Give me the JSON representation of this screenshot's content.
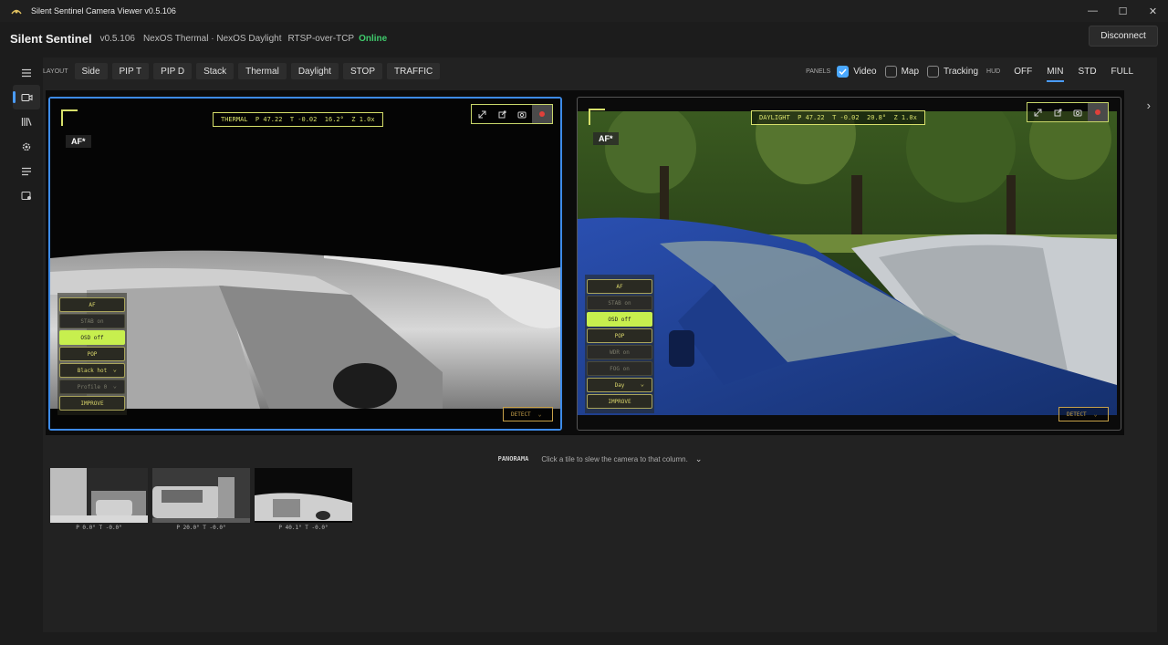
{
  "window": {
    "title": "Silent Sentinel Camera Viewer v0.5.106",
    "minimize": "—",
    "maximize": "☐",
    "close": "✕"
  },
  "header": {
    "brand": "Silent Sentinel",
    "version": "v0.5.106",
    "cameras": "NexOS Thermal · NexOS Daylight",
    "protocol": "RTSP-over-TCP",
    "status": "Online",
    "status_color": "#3fca6c",
    "disconnect_label": "Disconnect"
  },
  "sidebar": {
    "items": [
      {
        "icon": "menu-icon"
      },
      {
        "icon": "camera-icon",
        "active": true
      },
      {
        "icon": "library-icon"
      },
      {
        "icon": "gear-icon"
      },
      {
        "icon": "list-icon"
      },
      {
        "icon": "device-icon"
      }
    ]
  },
  "toolbar": {
    "layout_label": "LAYOUT",
    "layouts": [
      "Side",
      "PIP T",
      "PIP D",
      "Stack",
      "Thermal",
      "Daylight",
      "STOP",
      "TRAFFIC"
    ],
    "panels_label": "PANELS",
    "panels": [
      {
        "label": "Video",
        "checked": true
      },
      {
        "label": "Map",
        "checked": false
      },
      {
        "label": "Tracking",
        "checked": false
      }
    ],
    "hud_label": "HUD",
    "hud_options": [
      "OFF",
      "MIN",
      "STD",
      "FULL"
    ],
    "hud_selected": "MIN"
  },
  "thermal": {
    "hud": "THERMAL  P 47.22  T -0.02  16.2°  Z 1.0x",
    "af_tag": "AF*",
    "controls": [
      {
        "label": "AF",
        "state": "normal"
      },
      {
        "label": "STAB on",
        "state": "dim"
      },
      {
        "label": "OSD off",
        "state": "lit"
      },
      {
        "label": "POP",
        "state": "normal"
      },
      {
        "label": "Black hot",
        "state": "normal",
        "caret": true
      },
      {
        "label": "Profile 0",
        "state": "dim",
        "caret": true
      },
      {
        "label": "IMPROVE",
        "state": "normal"
      }
    ],
    "detect": "DETECT"
  },
  "daylight": {
    "hud": "DAYLIGHT  P 47.22  T -0.02  20.8°  Z 1.0x",
    "af_tag": "AF*",
    "controls": [
      {
        "label": "AF",
        "state": "normal"
      },
      {
        "label": "STAB on",
        "state": "dim"
      },
      {
        "label": "OSD off",
        "state": "lit"
      },
      {
        "label": "POP",
        "state": "normal"
      },
      {
        "label": "WDR on",
        "state": "dim"
      },
      {
        "label": "FOG on",
        "state": "dim"
      },
      {
        "label": "Day",
        "state": "normal",
        "caret": true
      },
      {
        "label": "IMPROVE",
        "state": "normal"
      }
    ],
    "detect": "DETECT"
  },
  "panorama": {
    "title": "PANORAMA",
    "hint": "Click a tile to slew the camera to that column.",
    "tiles": [
      {
        "caption": "P 0.0° T -0.0°"
      },
      {
        "caption": "P 20.0° T -0.0°"
      },
      {
        "caption": "P 40.1° T -0.0°"
      }
    ]
  }
}
